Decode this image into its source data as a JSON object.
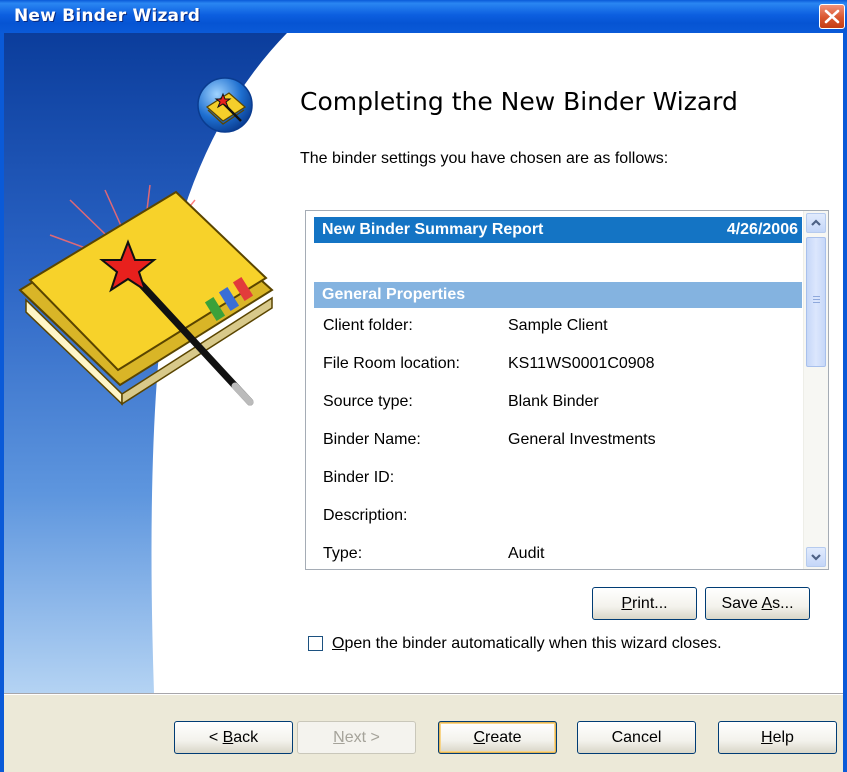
{
  "window": {
    "title": "New Binder Wizard"
  },
  "main": {
    "heading": "Completing the New Binder Wizard",
    "intro": "The binder settings you have chosen are as follows:"
  },
  "report": {
    "title": "New Binder Summary Report",
    "date": "4/26/2006",
    "section": "General Properties",
    "rows": [
      {
        "label": "Client folder:",
        "value": "Sample Client"
      },
      {
        "label": "File Room location:",
        "value": "KS11WS0001C0908"
      },
      {
        "label": "Source type:",
        "value": "Blank Binder"
      },
      {
        "label": "Binder Name:",
        "value": "General Investments"
      },
      {
        "label": "Binder ID:",
        "value": ""
      },
      {
        "label": "Description:",
        "value": ""
      },
      {
        "label": "Type:",
        "value": "Audit"
      }
    ]
  },
  "actions": {
    "print_pre": "",
    "print_key": "P",
    "print_post": "rint...",
    "save_pre": "Save ",
    "save_key": "A",
    "save_post": "s..."
  },
  "checkbox": {
    "key": "O",
    "label_rest": "pen the binder automatically when this wizard closes.",
    "checked": false
  },
  "footer": {
    "back_prefix": "< ",
    "back_key": "B",
    "back_rest": "ack",
    "next_key": "N",
    "next_rest": "ext >",
    "create_key": "C",
    "create_rest": "reate",
    "cancel": "Cancel",
    "help_key": "H",
    "help_rest": "elp"
  }
}
